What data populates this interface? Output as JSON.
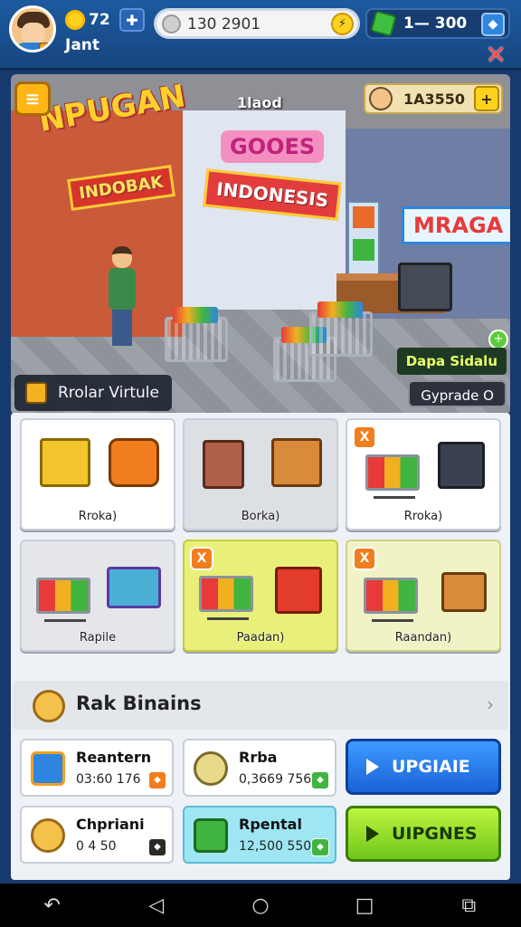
{
  "header": {
    "player_name": "Jant",
    "level_value": "72",
    "coins": "130 2901",
    "gems": "1—  300",
    "close_label": "✕"
  },
  "scene": {
    "top_label": "1laod",
    "cash": "1A3550",
    "cash_plus": "+",
    "menu_icon": "≡",
    "signs": {
      "npugan": "NPUGAN",
      "indo_left": "INDOBAK",
      "gooes": "GOOES",
      "indo_mid": "INDONESIS",
      "mraga": "MRAGA"
    },
    "tag": "Rrolar Virtule",
    "green_badge": "Dapa Sidalu",
    "upgrade_label": "Gyprade  O"
  },
  "cards": [
    {
      "label": "Rroka)",
      "style": "white",
      "badge": ""
    },
    {
      "label": "Borka)",
      "style": "gray",
      "badge": ""
    },
    {
      "label": "Rroka)",
      "style": "white",
      "badge": "X"
    },
    {
      "label": "Rapile",
      "style": "lgray",
      "badge": ""
    },
    {
      "label": "Paadan)",
      "style": "yellow",
      "badge": "X"
    },
    {
      "label": "Raandan)",
      "style": "lyellow",
      "badge": "X"
    }
  ],
  "section": {
    "title": "Rak Binains",
    "chevron": "›"
  },
  "stats": [
    {
      "title": "Reantern",
      "sub": "03:60 176"
    },
    {
      "title": "Rrba",
      "sub": "0,3669 756"
    },
    {
      "title": "Chpriani",
      "sub": "0 4 50"
    },
    {
      "title": "Rpental",
      "sub": "12,500 550"
    }
  ],
  "actions": {
    "upgrade_blue": "UPGIAIE",
    "upgrade_green": "UIPGNES"
  },
  "nav": [
    "↶",
    "◁",
    "○",
    "□",
    "⧉"
  ],
  "colors": {
    "top_bar": "#1c5aa0",
    "action_blue": "#1a63d6",
    "action_green": "#70c61a"
  }
}
